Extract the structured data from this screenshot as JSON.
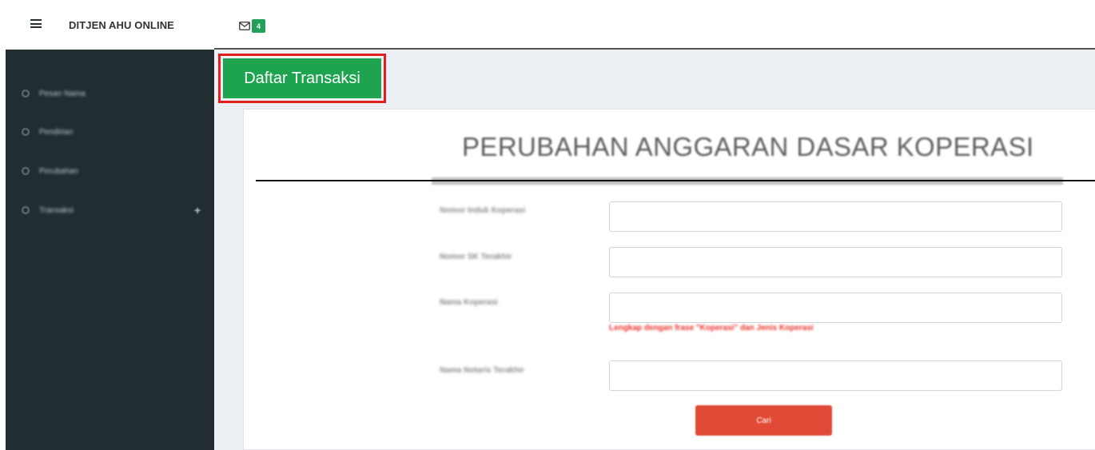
{
  "topbar": {
    "brand": "DITJEN AHU ONLINE",
    "mail_count": "4"
  },
  "sidebar": {
    "items": [
      {
        "label": "Pesan Nama"
      },
      {
        "label": "Pendirian"
      },
      {
        "label": "Perubahan"
      },
      {
        "label": "Transaksi",
        "expand": "+"
      }
    ]
  },
  "page": {
    "tab_label": "Daftar Transaksi",
    "title": "PERUBAHAN ANGGARAN DASAR KOPERASI"
  },
  "form": {
    "fields": [
      {
        "label": "Nomor Induk Koperasi",
        "value": ""
      },
      {
        "label": "Nomor SK Terakhir",
        "value": ""
      },
      {
        "label": "Nama Koperasi",
        "value": ""
      },
      {
        "label": "Nama Notaris Terakhir",
        "value": ""
      }
    ],
    "hint": "Lengkap dengan frase \"Koperasi\" dan Jenis Koperasi",
    "submit_label": "Cari"
  },
  "colors": {
    "accent_green": "#1ea34e",
    "highlight_red": "#e0201c",
    "button_red": "#e04a36",
    "sidebar_bg": "#222d32"
  }
}
